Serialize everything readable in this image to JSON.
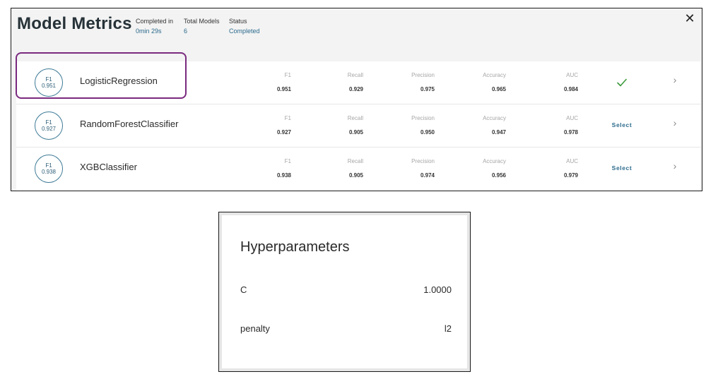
{
  "header": {
    "title": "Model Metrics",
    "stats": [
      {
        "label": "Completed in",
        "value": "0min 29s"
      },
      {
        "label": "Total Models",
        "value": "6"
      },
      {
        "label": "Status",
        "value": "Completed"
      }
    ],
    "close_icon": "close-icon",
    "close_glyph": "✕"
  },
  "metric_labels": {
    "f1": "F1",
    "recall": "Recall",
    "precision": "Precision",
    "accuracy": "Accuracy",
    "auc": "AUC"
  },
  "models": [
    {
      "badge_label": "F1",
      "badge_value": "0.951",
      "name": "LogisticRegression",
      "f1": "0.951",
      "recall": "0.929",
      "precision": "0.975",
      "accuracy": "0.965",
      "auc": "0.984",
      "selected": true,
      "action_label": ""
    },
    {
      "badge_label": "F1",
      "badge_value": "0.927",
      "name": "RandomForestClassifier",
      "f1": "0.927",
      "recall": "0.905",
      "precision": "0.950",
      "accuracy": "0.947",
      "auc": "0.978",
      "selected": false,
      "action_label": "Select"
    },
    {
      "badge_label": "F1",
      "badge_value": "0.938",
      "name": "XGBClassifier",
      "f1": "0.938",
      "recall": "0.905",
      "precision": "0.974",
      "accuracy": "0.956",
      "auc": "0.979",
      "selected": false,
      "action_label": "Select"
    }
  ],
  "chevron_glyph": "›",
  "colors": {
    "accent": "#2b6a8c",
    "selected_outline": "#7a2a7f",
    "check": "#3c9a3c"
  },
  "hyperparameters": {
    "title": "Hyperparameters",
    "params": [
      {
        "name": "C",
        "value": "1.0000"
      },
      {
        "name": "penalty",
        "value": "l2"
      }
    ]
  }
}
